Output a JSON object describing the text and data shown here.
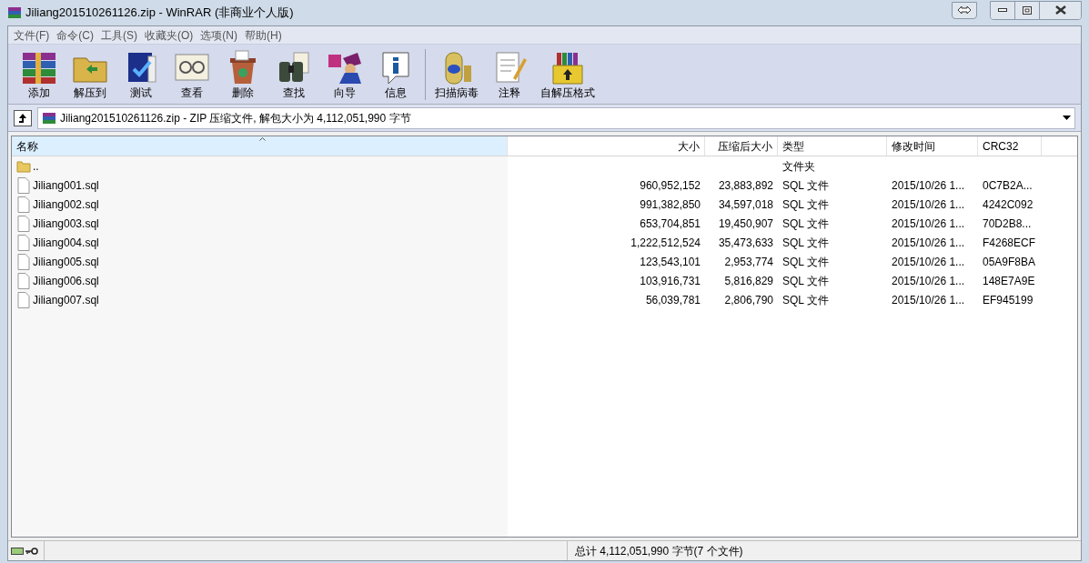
{
  "window": {
    "title": "Jiliang201510261126.zip - WinRAR (非商业个人版)"
  },
  "menu": [
    "文件(F)",
    "命令(C)",
    "工具(S)",
    "收藏夹(O)",
    "选项(N)",
    "帮助(H)"
  ],
  "toolbar_groups": [
    [
      {
        "label": "添加",
        "kind": "add"
      },
      {
        "label": "解压到",
        "kind": "extract"
      },
      {
        "label": "测试",
        "kind": "test"
      },
      {
        "label": "查看",
        "kind": "view"
      },
      {
        "label": "删除",
        "kind": "delete"
      },
      {
        "label": "查找",
        "kind": "find"
      },
      {
        "label": "向导",
        "kind": "wizard"
      },
      {
        "label": "信息",
        "kind": "info"
      }
    ],
    [
      {
        "label": "扫描病毒",
        "kind": "scan"
      },
      {
        "label": "注释",
        "kind": "comment"
      },
      {
        "label": "自解压格式",
        "kind": "sfx"
      }
    ]
  ],
  "address": "Jiliang201510261126.zip - ZIP 压缩文件, 解包大小为 4,112,051,990 字节",
  "table": {
    "columns": [
      {
        "label": "名称",
        "sorted": true
      },
      {
        "label": "大小",
        "sorted": false
      },
      {
        "label": "压缩后大小",
        "sorted": false
      },
      {
        "label": "类型",
        "sorted": false
      },
      {
        "label": "修改时间",
        "sorted": false
      },
      {
        "label": "CRC32",
        "sorted": false
      }
    ],
    "rows": [
      {
        "kind": "folder",
        "cells": [
          "..",
          "",
          "",
          "文件夹",
          "",
          ""
        ]
      },
      {
        "kind": "file",
        "cells": [
          "Jiliang001.sql",
          "960,952,152",
          "23,883,892",
          "SQL 文件",
          "2015/10/26 1...",
          "0C7B2A..."
        ]
      },
      {
        "kind": "file",
        "cells": [
          "Jiliang002.sql",
          "991,382,850",
          "34,597,018",
          "SQL 文件",
          "2015/10/26 1...",
          "4242C092"
        ]
      },
      {
        "kind": "file",
        "cells": [
          "Jiliang003.sql",
          "653,704,851",
          "19,450,907",
          "SQL 文件",
          "2015/10/26 1...",
          "70D2B8..."
        ]
      },
      {
        "kind": "file",
        "cells": [
          "Jiliang004.sql",
          "1,222,512,524",
          "35,473,633",
          "SQL 文件",
          "2015/10/26 1...",
          "F4268ECF"
        ]
      },
      {
        "kind": "file",
        "cells": [
          "Jiliang005.sql",
          "123,543,101",
          "2,953,774",
          "SQL 文件",
          "2015/10/26 1...",
          "05A9F8BA"
        ]
      },
      {
        "kind": "file",
        "cells": [
          "Jiliang006.sql",
          "103,916,731",
          "5,816,829",
          "SQL 文件",
          "2015/10/26 1...",
          "148E7A9E"
        ]
      },
      {
        "kind": "file",
        "cells": [
          "Jiliang007.sql",
          "56,039,781",
          "2,806,790",
          "SQL 文件",
          "2015/10/26 1...",
          "EF945199"
        ]
      }
    ]
  },
  "status_bar": "总计 4,112,051,990 字节(7 个文件)"
}
